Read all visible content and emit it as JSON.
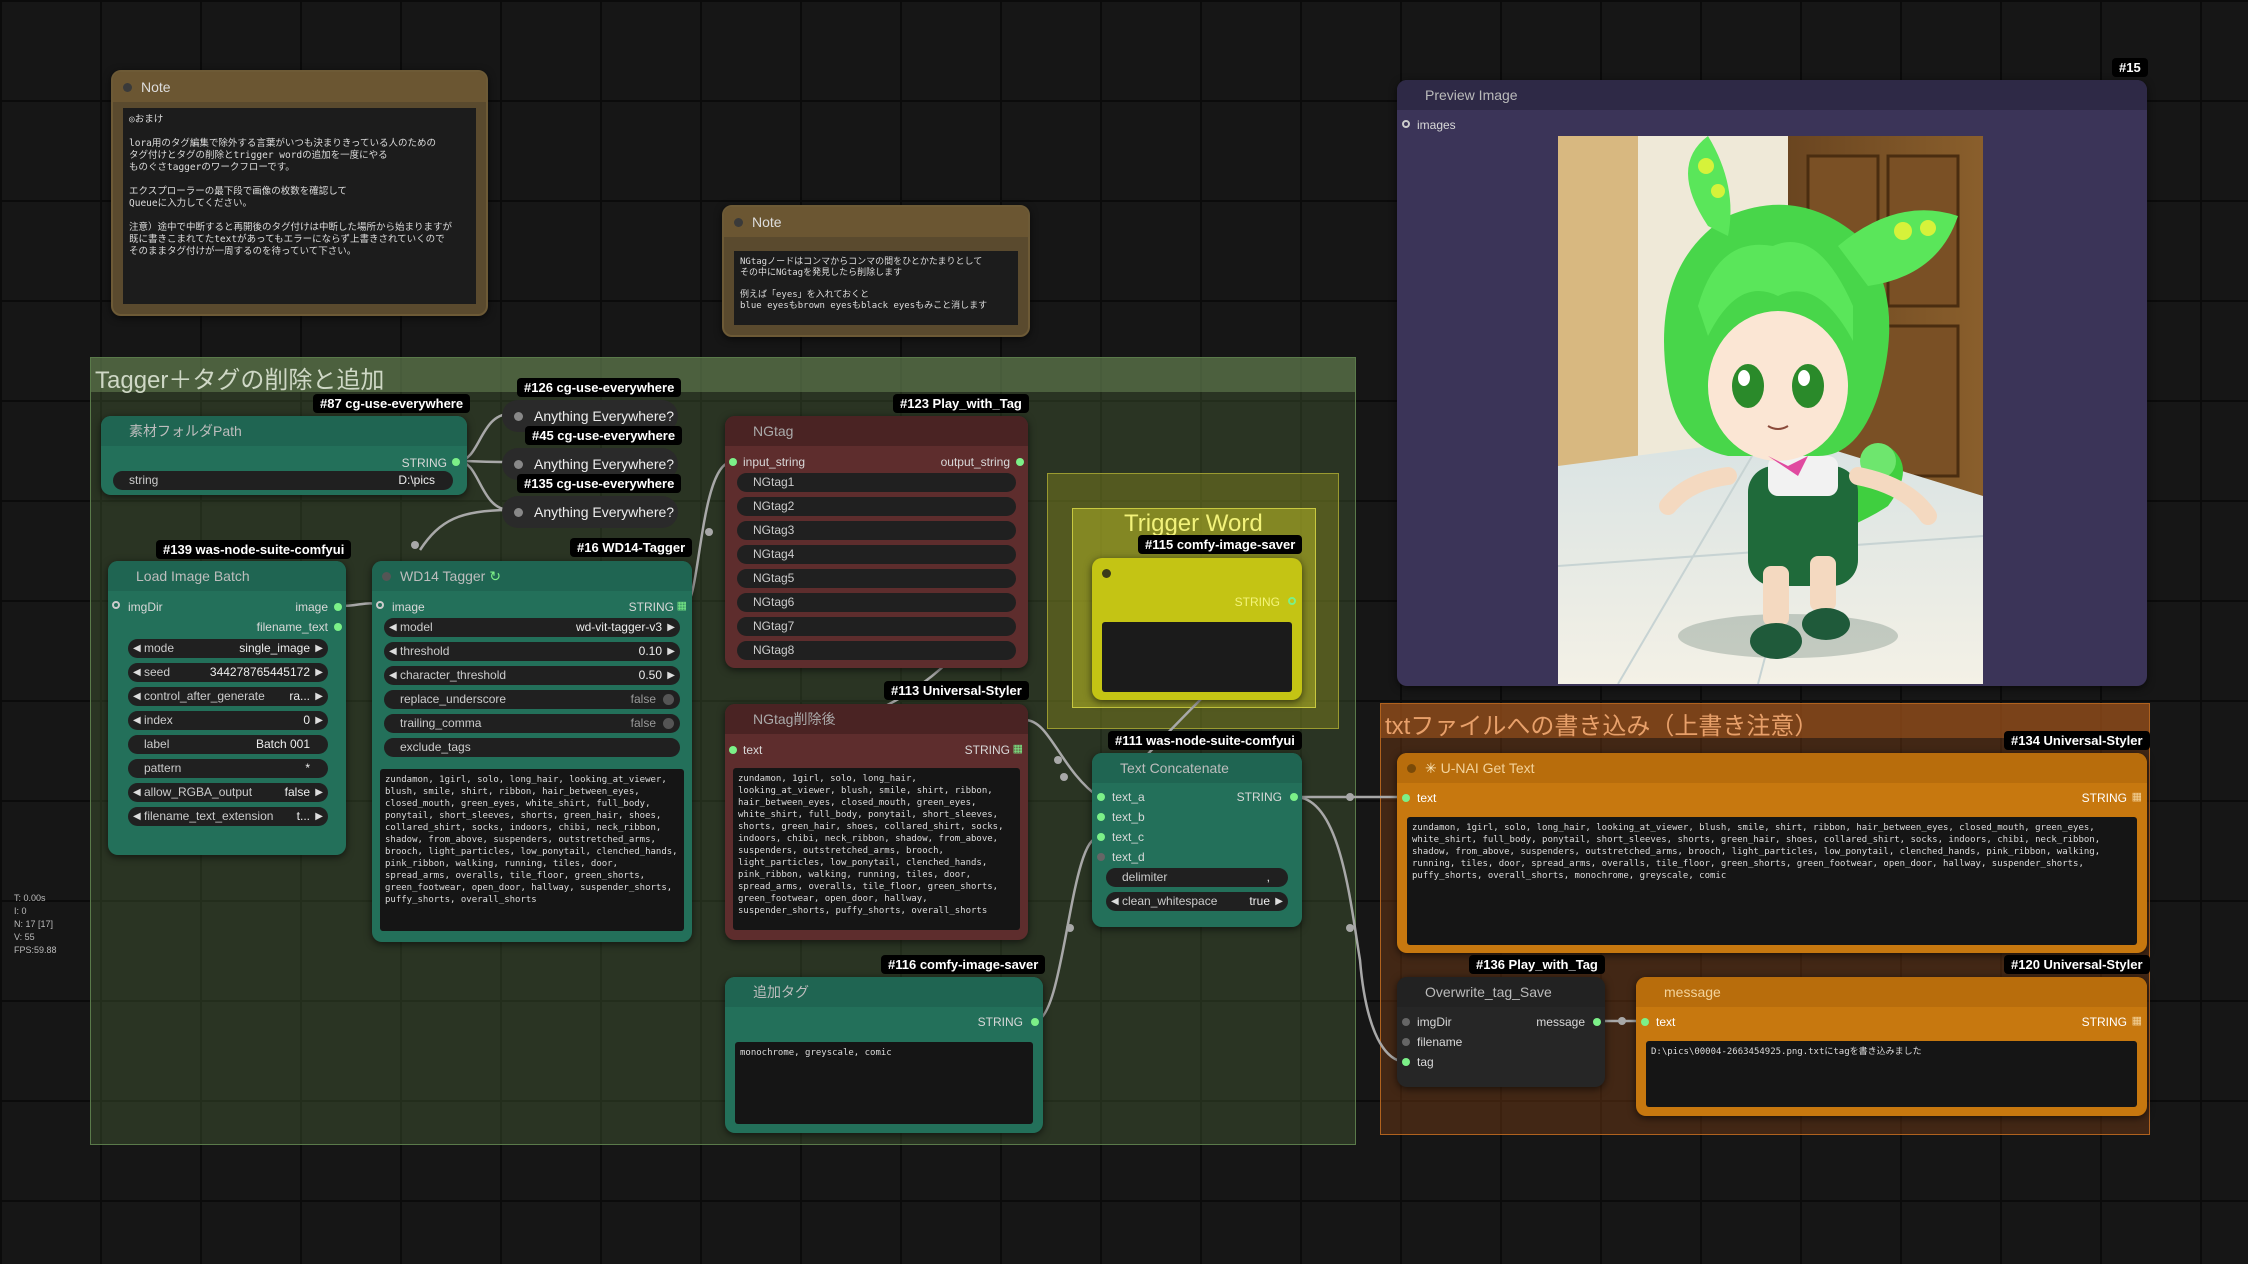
{
  "groups": {
    "tagger": {
      "title": "Tagger＋タグの削除と追加"
    },
    "trigger": {
      "title": "Trigger Word"
    },
    "txt_write": {
      "title": "txtファイルへの書き込み（上書き注意）"
    }
  },
  "notes": {
    "note1": {
      "title": "Note",
      "text": "◎おまけ\n\nlora用のタグ編集で除外する言葉がいつも決まりきっている人のための\nタグ付けとタグの削除とtrigger wordの追加を一度にやる\nものぐさtaggerのワークフローです。\n\nエクスプローラーの最下段で画像の枚数を確認して\nQueueに入力してください。\n\n注意）途中で中断すると再開後のタグ付けは中断した場所から始まりますが\n既に書きこまれてたtextがあってもエラーにならず上書きされていくので\nそのままタグ付けが一周するのを待っていて下さい。"
    },
    "note2": {
      "title": "Note",
      "text": "NGtagノードはコンマからコンマの間をひとかたまりとして\nその中にNGtagを発見したら削除します\n\n例えば「eyes」を入れておくと\nblue eyesもbrown eyesもblack eyesもみこと消します"
    }
  },
  "badges": {
    "b15": "#15",
    "b87": "#87 cg-use-everywhere",
    "b126": "#126 cg-use-everywhere",
    "b45": "#45 cg-use-everywhere",
    "b135": "#135 cg-use-everywhere",
    "b139": "#139 was-node-suite-comfyui",
    "b16": "#16 WD14-Tagger",
    "b123": "#123 Play_with_Tag",
    "b115": "#115 comfy-image-saver",
    "b113": "#113 Universal-Styler",
    "b111": "#111 was-node-suite-comfyui",
    "b116": "#116 comfy-image-saver",
    "b134": "#134 Universal-Styler",
    "b136": "#136 Play_with_Tag",
    "b120": "#120 Universal-Styler"
  },
  "anything_everywhere": {
    "label": "Anything Everywhere?"
  },
  "sozai": {
    "title": "素材フォルダPath",
    "out": "STRING",
    "w_label": "string",
    "w_value": "D:\\pics"
  },
  "lib": {
    "title": "Load Image Batch",
    "in_imgdir": "imgDir",
    "out_image": "image",
    "out_filename": "filename_text",
    "widgets": [
      {
        "label": "mode",
        "value": "single_image"
      },
      {
        "label": "seed",
        "value": "344278765445172"
      },
      {
        "label": "control_after_generate",
        "value": "ra..."
      },
      {
        "label": "index",
        "value": "0"
      },
      {
        "label": "label",
        "value": "Batch 001"
      },
      {
        "label": "pattern",
        "value": "*"
      },
      {
        "label": "allow_RGBA_output",
        "value": "false"
      },
      {
        "label": "filename_text_extension",
        "value": "t..."
      }
    ]
  },
  "wd14": {
    "title": "WD14 Tagger",
    "in_image": "image",
    "out": "STRING",
    "widgets": [
      {
        "label": "model",
        "value": "wd-vit-tagger-v3"
      },
      {
        "label": "threshold",
        "value": "0.10"
      },
      {
        "label": "character_threshold",
        "value": "0.50"
      },
      {
        "label": "replace_underscore",
        "value": "false"
      },
      {
        "label": "trailing_comma",
        "value": "false"
      },
      {
        "label": "exclude_tags",
        "value": ""
      }
    ],
    "text": "zundamon, 1girl, solo, long_hair, looking_at_viewer, blush, smile, shirt, ribbon, hair_between_eyes, closed_mouth, green_eyes, white_shirt, full_body, ponytail, short_sleeves, shorts, green_hair, shoes, collared_shirt, socks, indoors, chibi, neck_ribbon, shadow, from_above, suspenders, outstretched_arms, brooch, light_particles, low_ponytail, clenched_hands, pink_ribbon, walking, running, tiles, door, spread_arms, overalls, tile_floor, green_shorts, green_footwear, open_door, hallway, suspender_shorts, puffy_shorts, overall_shorts"
  },
  "ngtag": {
    "title": "NGtag",
    "in": "input_string",
    "out": "output_string",
    "fields": [
      "NGtag1",
      "NGtag2",
      "NGtag3",
      "NGtag4",
      "NGtag5",
      "NGtag6",
      "NGtag7",
      "NGtag8"
    ]
  },
  "ngafter": {
    "title": "NGtag削除後",
    "in": "text",
    "out": "STRING",
    "text": "zundamon, 1girl, solo, long_hair, looking_at_viewer, blush, smile, shirt, ribbon, hair_between_eyes, closed_mouth, green_eyes, white_shirt, full_body, ponytail, short_sleeves, shorts, green_hair, shoes, collared_shirt, socks, indoors, chibi, neck_ribbon, shadow, from_above, suspenders, outstretched_arms, brooch, light_particles, low_ponytail, clenched_hands, pink_ribbon, walking, running, tiles, door, spread_arms, overalls, tile_floor, green_shorts, green_footwear, open_door, hallway, suspender_shorts, puffy_shorts, overall_shorts"
  },
  "trigger": {
    "out": "STRING"
  },
  "concat": {
    "title": "Text Concatenate",
    "inputs": [
      "text_a",
      "text_b",
      "text_c",
      "text_d"
    ],
    "out": "STRING",
    "delimiter_label": "delimiter",
    "delimiter_value": ",",
    "cw_label": "clean_whitespace",
    "cw_value": "true"
  },
  "addtag": {
    "title": "追加タグ",
    "out": "STRING",
    "text": "monochrome, greyscale, comic"
  },
  "preview": {
    "title": "Preview Image",
    "in": "images"
  },
  "unai": {
    "title": "U-NAI Get Text",
    "in": "text",
    "out": "STRING",
    "text": "zundamon, 1girl, solo, long_hair, looking_at_viewer, blush, smile, shirt, ribbon, hair_between_eyes, closed_mouth, green_eyes, white_shirt, full_body, ponytail, short_sleeves, shorts, green_hair, shoes, collared_shirt, socks, indoors, chibi, neck_ribbon, shadow, from_above, suspenders, outstretched_arms, brooch, light_particles, low_ponytail, clenched_hands, pink_ribbon, walking, running, tiles, door, spread_arms, overalls, tile_floor, green_shorts, green_footwear, open_door, hallway, suspender_shorts, puffy_shorts, overall_shorts, monochrome, greyscale, comic"
  },
  "overwrite": {
    "title": "Overwrite_tag_Save",
    "inputs": [
      "imgDir",
      "filename",
      "tag"
    ],
    "out": "message"
  },
  "message": {
    "title": "message",
    "in": "text",
    "out": "STRING",
    "text": "D:\\pics\\00004-2663454925.png.txtにtagを書き込みました"
  },
  "stats": {
    "t": "T: 0.00s",
    "i": "I: 0",
    "n": "N: 17 [17]",
    "v": "V: 55",
    "fps": "FPS:59.88"
  },
  "colors": {
    "teal_node": "#23705a",
    "red_node": "#5e2d2d",
    "orange_node": "#c7780f",
    "preview_node": "#3b3458",
    "link": "#aaaaaa",
    "socket": "#7cf088"
  }
}
